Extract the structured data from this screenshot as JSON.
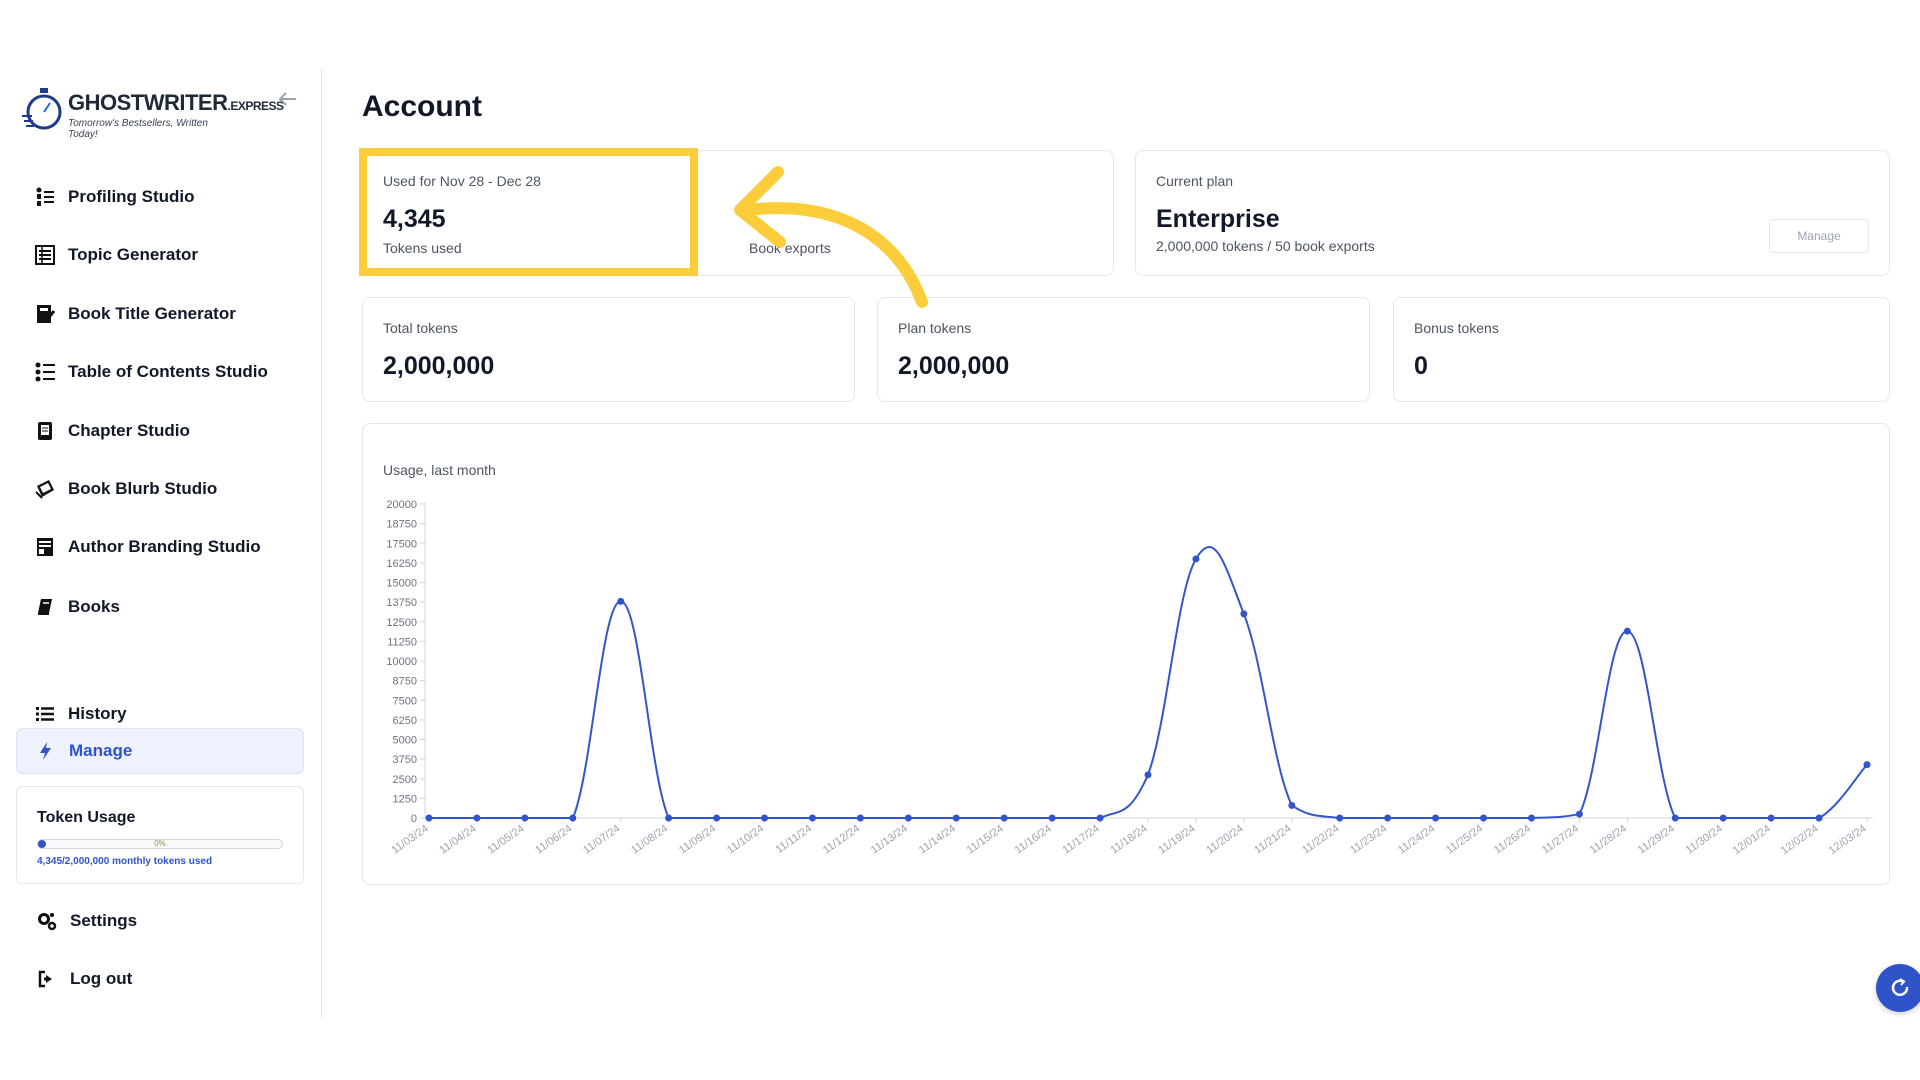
{
  "sidebar": {
    "logo": {
      "brand_main": "GHOSTWRITER",
      "brand_suffix": ".EXPRESS",
      "tagline": "Tomorrow's Bestsellers, Written Today!"
    },
    "items": [
      {
        "label": "Profiling Studio",
        "icon": "profiling-icon"
      },
      {
        "label": "Topic Generator",
        "icon": "topic-icon"
      },
      {
        "label": "Book Title Generator",
        "icon": "book-title-icon"
      },
      {
        "label": "Table of Contents Studio",
        "icon": "toc-icon"
      },
      {
        "label": "Chapter Studio",
        "icon": "chapter-icon"
      },
      {
        "label": "Book Blurb Studio",
        "icon": "blurb-icon"
      },
      {
        "label": "Author Branding Studio",
        "icon": "branding-icon"
      },
      {
        "label": "Books",
        "icon": "books-icon"
      }
    ],
    "history_label": "History",
    "manage_label": "Manage",
    "token_usage": {
      "title": "Token Usage",
      "percent_label": "0%",
      "fraction": 0.002,
      "text": "4,345/2,000,000 monthly tokens used"
    },
    "settings_label": "Settings",
    "logout_label": "Log out"
  },
  "main": {
    "title": "Account",
    "usage_card": {
      "label": "Used for Nov 28 - Dec 28",
      "tokens_value": "4,345",
      "tokens_caption": "Tokens used",
      "exports_caption": "Book exports"
    },
    "plan_card": {
      "label": "Current plan",
      "plan_name": "Enterprise",
      "plan_desc": "2,000,000 tokens / 50 book exports",
      "manage_label": "Manage"
    },
    "stats": [
      {
        "label": "Total tokens",
        "value": "2,000,000"
      },
      {
        "label": "Plan tokens",
        "value": "2,000,000"
      },
      {
        "label": "Bonus tokens",
        "value": "0"
      }
    ]
  },
  "colors": {
    "accent": "#2f54c9",
    "highlight": "#fccd3b",
    "line": "#3355cc"
  },
  "chart_data": {
    "type": "line",
    "title": "Usage, last month",
    "x": [
      "11/03/24",
      "11/04/24",
      "11/05/24",
      "11/06/24",
      "11/07/24",
      "11/08/24",
      "11/09/24",
      "11/10/24",
      "11/11/24",
      "11/12/24",
      "11/13/24",
      "11/14/24",
      "11/15/24",
      "11/16/24",
      "11/17/24",
      "11/18/24",
      "11/19/24",
      "11/20/24",
      "11/21/24",
      "11/22/24",
      "11/23/24",
      "11/24/24",
      "11/25/24",
      "11/26/24",
      "11/27/24",
      "11/28/24",
      "11/29/24",
      "11/30/24",
      "12/01/24",
      "12/02/24",
      "12/03/24"
    ],
    "values": [
      0,
      0,
      0,
      0,
      13800,
      0,
      0,
      0,
      0,
      0,
      0,
      0,
      0,
      0,
      0,
      2750,
      16500,
      13000,
      800,
      0,
      0,
      0,
      0,
      0,
      250,
      11900,
      0,
      0,
      0,
      0,
      3400
    ],
    "ylim": [
      0,
      20000
    ],
    "yticks": [
      0,
      1250,
      2500,
      3750,
      5000,
      6250,
      7500,
      8750,
      10000,
      11250,
      12500,
      13750,
      15000,
      16250,
      17500,
      18750,
      20000
    ],
    "grid": false,
    "legend": "none"
  }
}
